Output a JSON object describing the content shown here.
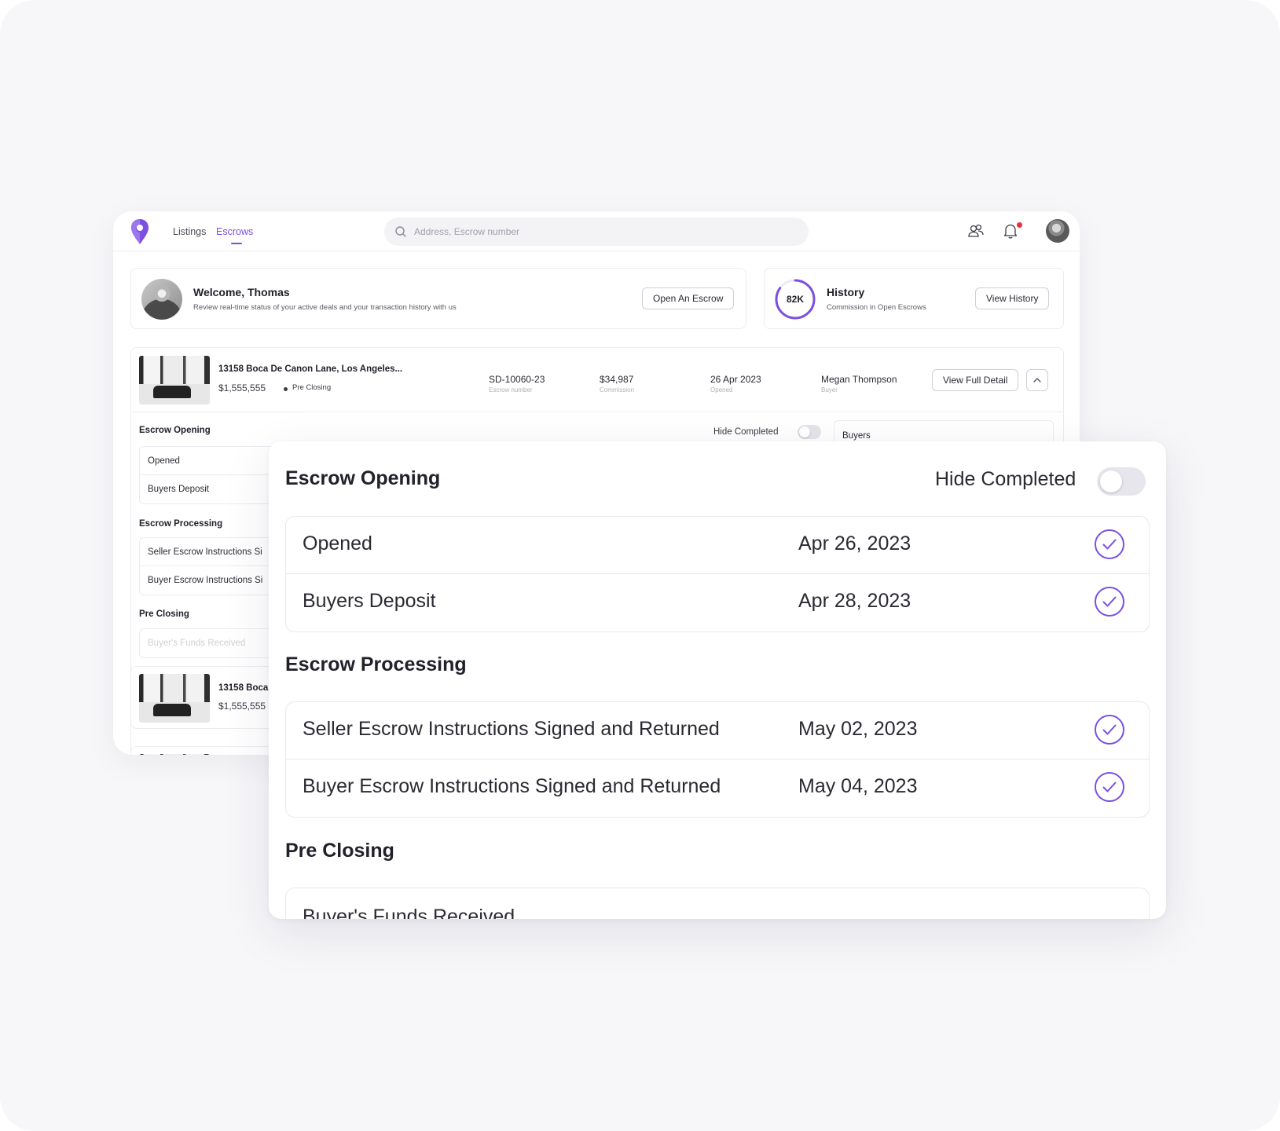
{
  "nav": {
    "listings": "Listings",
    "escrows": "Escrows"
  },
  "search": {
    "placeholder": "Address, Escrow number"
  },
  "welcome": {
    "title": "Welcome, Thomas",
    "subtitle": "Review real-time status of your active deals and your transaction history with us",
    "button": "Open An Escrow"
  },
  "history": {
    "value": "82K",
    "title": "History",
    "subtitle": "Commission in Open Escrows",
    "button": "View History",
    "progress": 0.85
  },
  "escrow": {
    "address": "13158 Boca De Canon Lane, Los Angeles...",
    "address_short": "13158 Boca",
    "price": "$1,555,555",
    "status": "Pre Closing",
    "escrow_number": "SD-10060-23",
    "escrow_number_label": "Escrow number",
    "commission": "$34,987",
    "commission_label": "Commission",
    "opened": "26 Apr 2023",
    "opened_label": "Opened",
    "buyer": "Megan Thompson",
    "buyer_label": "Buyer",
    "detail_button": "View Full Detail",
    "hide_completed": "Hide Completed",
    "buyers_panel": "Buyers"
  },
  "sections": {
    "opening": "Escrow Opening",
    "processing": "Escrow Processing",
    "pre_closing": "Pre Closing"
  },
  "mini": {
    "opened": "Opened",
    "buyers_deposit": "Buyers Deposit",
    "seller_instr": "Seller Escrow Instructions Si",
    "buyer_instr": "Buyer Escrow Instructions Si",
    "funds": "Buyer's Funds Received"
  },
  "zoom": {
    "hide_completed": "Hide Completed",
    "opening_rows": [
      {
        "name": "Opened",
        "date": "Apr 26, 2023"
      },
      {
        "name": "Buyers Deposit",
        "date": "Apr 28, 2023"
      }
    ],
    "processing_rows": [
      {
        "name": "Seller Escrow Instructions Signed and Returned",
        "date": "May 02, 2023"
      },
      {
        "name": "Buyer Escrow Instructions Signed and Returned",
        "date": "May 04, 2023"
      }
    ],
    "pre_closing_rows": [
      {
        "name": "Buyer's Funds Received"
      }
    ]
  },
  "colors": {
    "accent": "#7b4fe0",
    "notification": "#e8323c"
  },
  "icons": {
    "logo": "location-pin-logo",
    "search": "search-icon",
    "users": "users-icon",
    "bell": "bell-icon",
    "check": "check-circle-icon",
    "chevron": "chevron-up-icon"
  }
}
